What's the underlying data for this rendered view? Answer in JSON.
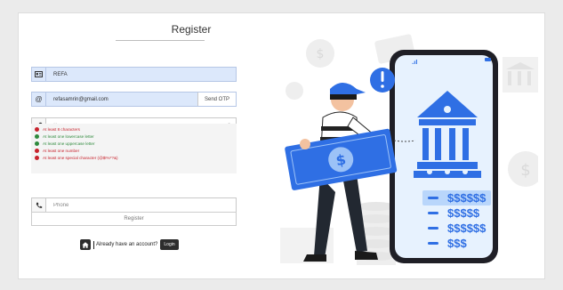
{
  "form": {
    "title": "Register",
    "name_value": "REFA",
    "email_value": "refasamrin@gmail.com",
    "send_otp_label": "Send OTP",
    "password_value": "••",
    "phone_placeholder": "Phone",
    "register_label": "Register",
    "have_account_text": "Already have an account?",
    "login_label": "Login"
  },
  "password_rules": [
    {
      "text": "At least 8 characters",
      "status": "fail"
    },
    {
      "text": "At least one lowercase letter",
      "status": "pass"
    },
    {
      "text": "At least one uppercase letter",
      "status": "pass"
    },
    {
      "text": "At least one number",
      "status": "fail"
    },
    {
      "text": "At least one special character (@$!%*?&)",
      "status": "fail"
    }
  ],
  "illustration": {
    "money_lines": [
      "$$$$$$",
      "$$$$$",
      "$$$$$$",
      "$$$"
    ]
  },
  "colors": {
    "accent_blue": "#2f6fe4",
    "error_red": "#c8232d",
    "success_green": "#2f8a3d",
    "filled_field_bg": "#dce8fb"
  },
  "icons": {
    "name": "id-card-icon",
    "email": "at-sign-icon",
    "password": "key-icon",
    "show_password": "eye-icon",
    "phone": "phone-icon",
    "home": "home-icon"
  }
}
